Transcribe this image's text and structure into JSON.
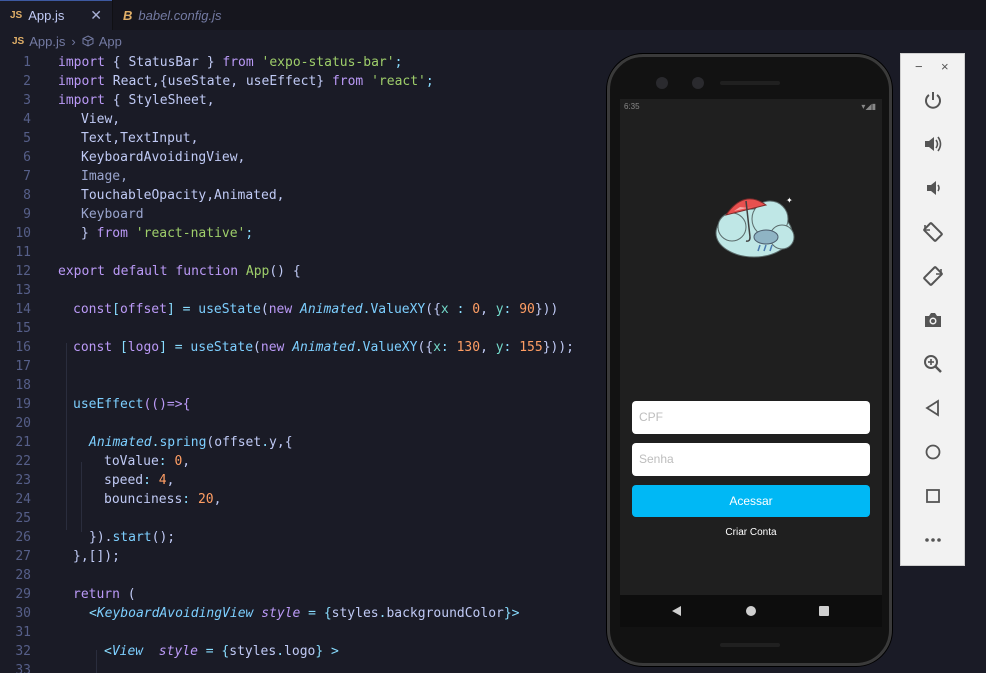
{
  "tabs": [
    {
      "icon": "JS",
      "label": "App.js",
      "close": "✕"
    },
    {
      "icon": "B",
      "label": "babel.config.js"
    }
  ],
  "breadcrumb": {
    "file_icon": "JS",
    "file": "App.js",
    "symbol": "App"
  },
  "code_lines": [
    {
      "n": "1"
    },
    {
      "n": "2"
    },
    {
      "n": "3"
    },
    {
      "n": "4"
    },
    {
      "n": "5"
    },
    {
      "n": "6"
    },
    {
      "n": "7"
    },
    {
      "n": "8"
    },
    {
      "n": "9"
    },
    {
      "n": "10"
    },
    {
      "n": "11"
    },
    {
      "n": "12"
    },
    {
      "n": "13"
    },
    {
      "n": "14"
    },
    {
      "n": "15"
    },
    {
      "n": "16"
    },
    {
      "n": "17"
    },
    {
      "n": "18"
    },
    {
      "n": "19"
    },
    {
      "n": "20"
    },
    {
      "n": "21"
    },
    {
      "n": "22"
    },
    {
      "n": "23"
    },
    {
      "n": "24"
    },
    {
      "n": "25"
    },
    {
      "n": "26"
    },
    {
      "n": "27"
    },
    {
      "n": "28"
    },
    {
      "n": "29"
    },
    {
      "n": "30"
    },
    {
      "n": "31"
    },
    {
      "n": "32"
    },
    {
      "n": "33"
    }
  ],
  "code": {
    "l1": [
      "import",
      " { StatusBar } ",
      "from",
      " ",
      "'expo-status-bar'",
      ";"
    ],
    "l2": [
      "import",
      " React,{useState, useEffect} ",
      "from",
      " ",
      "'react'",
      ";"
    ],
    "l3": [
      "import",
      " { StyleSheet,"
    ],
    "l4": "View,",
    "l5": "Text,TextInput,",
    "l6": "KeyboardAvoidingView,",
    "l7": "Image,",
    "l8": "TouchableOpacity,Animated,",
    "l9": "Keyboard",
    "l10": [
      "} ",
      "from",
      " ",
      "'react-native'",
      ";"
    ],
    "l12": [
      "export",
      " ",
      "default",
      " ",
      "function",
      " ",
      "App",
      "() {"
    ],
    "l14": [
      "const",
      "[",
      "offset",
      "] = ",
      "useState",
      "(",
      "new",
      " ",
      "Animated",
      ".",
      "ValueXY",
      "({",
      "x",
      " : ",
      "0",
      ", ",
      "y",
      ": ",
      "90",
      "}))"
    ],
    "l16": [
      "const",
      " [",
      "logo",
      "] = ",
      "useState",
      "(",
      "new",
      " ",
      "Animated",
      ".",
      "ValueXY",
      "({",
      "x",
      ": ",
      "130",
      ", ",
      "y",
      ": ",
      "155",
      "}));"
    ],
    "l19": [
      "useEffect",
      "(()=>{"
    ],
    "l21": [
      "Animated",
      ".",
      "spring",
      "(",
      "offset",
      ".",
      "y",
      ",{"
    ],
    "l22": [
      "toValue",
      ": ",
      "0",
      ","
    ],
    "l23": [
      "speed",
      ": ",
      "4",
      ","
    ],
    "l24": [
      "bounciness",
      ": ",
      "20",
      ","
    ],
    "l26": [
      "}).",
      "start",
      "();"
    ],
    "l27": "},[]);",
    "l29": [
      "return",
      " ("
    ],
    "l30": [
      "<",
      "KeyboardAvoidingView",
      " ",
      "style",
      " = {",
      "styles",
      ".",
      "backgroundColor",
      "}>"
    ],
    "l32": [
      "<",
      "View",
      "  ",
      "style",
      " = {",
      "styles",
      ".",
      "logo",
      "} >"
    ]
  },
  "phone": {
    "status_time": "6:35",
    "cpf_placeholder": "CPF",
    "senha_placeholder": "Senha",
    "login_button": "Acessar",
    "signup_link": "Criar Conta"
  },
  "emulator": {
    "minimize": "−",
    "close": "×",
    "buttons": [
      "power-icon",
      "volume-up-icon",
      "volume-down-icon",
      "rotate-left-icon",
      "rotate-right-icon",
      "camera-icon",
      "zoom-icon",
      "back-icon",
      "home-icon",
      "overview-icon",
      "more-icon"
    ]
  },
  "colors": {
    "editor_bg": "#1a1b26",
    "keyword": "#bb9af7",
    "string": "#9ece6a",
    "number": "#ff9e64",
    "function": "#7aa2f7",
    "button_accent": "#00b8f5"
  }
}
